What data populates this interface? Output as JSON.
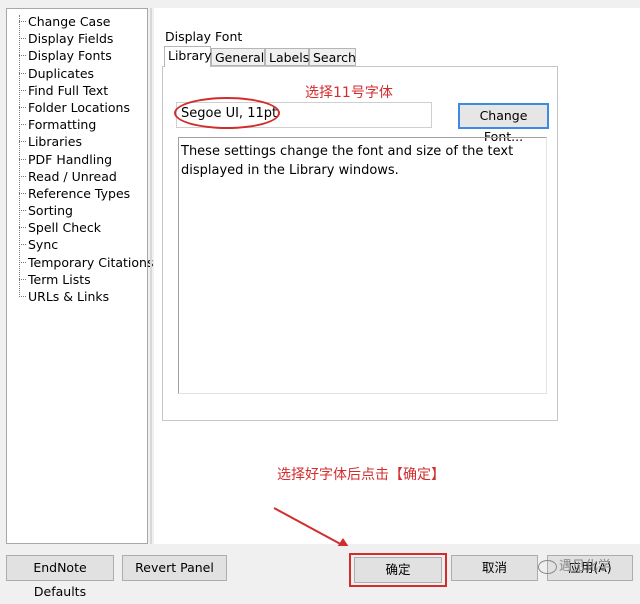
{
  "sidebar": {
    "items": [
      {
        "label": "Change Case"
      },
      {
        "label": "Display Fields"
      },
      {
        "label": "Display Fonts"
      },
      {
        "label": "Duplicates"
      },
      {
        "label": "Find Full Text"
      },
      {
        "label": "Folder Locations"
      },
      {
        "label": "Formatting"
      },
      {
        "label": "Libraries"
      },
      {
        "label": "PDF Handling"
      },
      {
        "label": "Read / Unread"
      },
      {
        "label": "Reference Types"
      },
      {
        "label": "Sorting"
      },
      {
        "label": "Spell Check"
      },
      {
        "label": "Sync"
      },
      {
        "label": "Temporary Citations"
      },
      {
        "label": "Term Lists"
      },
      {
        "label": "URLs & Links"
      }
    ]
  },
  "panel": {
    "title": "Display Font",
    "tabs": [
      {
        "label": "Library"
      },
      {
        "label": "General"
      },
      {
        "label": "Labels"
      },
      {
        "label": "Search"
      }
    ],
    "font_value": "Segoe UI, 11pt",
    "change_font_label": "Change Font...",
    "description": "These settings change the font and size of the text displayed in the Library windows."
  },
  "annotations": {
    "top": "选择11号字体",
    "bottom": "选择好字体后点击【确定】",
    "color": "#d22d2d"
  },
  "buttons": {
    "endnote_defaults": "EndNote Defaults",
    "revert_panel": "Revert Panel",
    "ok": "确定",
    "cancel": "取消",
    "apply": "应用(A)"
  },
  "watermark": "遇见化学"
}
